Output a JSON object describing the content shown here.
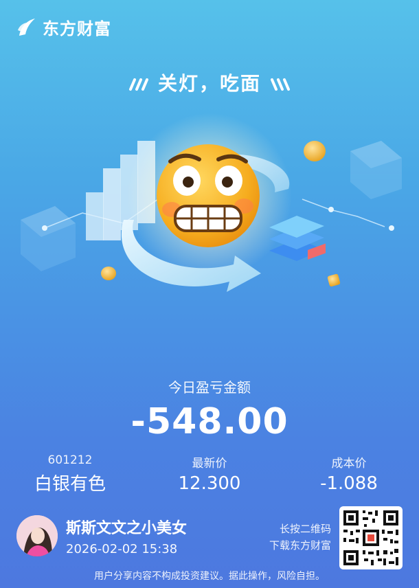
{
  "brand": {
    "name": "东方财富"
  },
  "headline": "关灯，吃面",
  "pnl": {
    "label": "今日盈亏金额",
    "value": "-548.00"
  },
  "stock": {
    "code": "601212",
    "name": "白银有色",
    "latest_label": "最新价",
    "latest_value": "12.300",
    "cost_label": "成本价",
    "cost_value": "-1.088"
  },
  "user": {
    "name": "斯斯文文之小美女",
    "time": "2026-02-02 15:38"
  },
  "qr": {
    "line1": "长按二维码",
    "line2": "下载东方财富"
  },
  "disclaimer": "用户分享内容不构成投资建议。据此操作，风险自担。",
  "colors": {
    "background_top": "#56c1ea",
    "background_bottom": "#4d78df",
    "emoji": "#f7b52a",
    "text": "#ffffff"
  },
  "icons": [
    "brand-logo-icon",
    "emoji-grimace-icon",
    "cycle-arrow-icon",
    "coin-icon",
    "qr-code-icon",
    "avatar-image"
  ]
}
